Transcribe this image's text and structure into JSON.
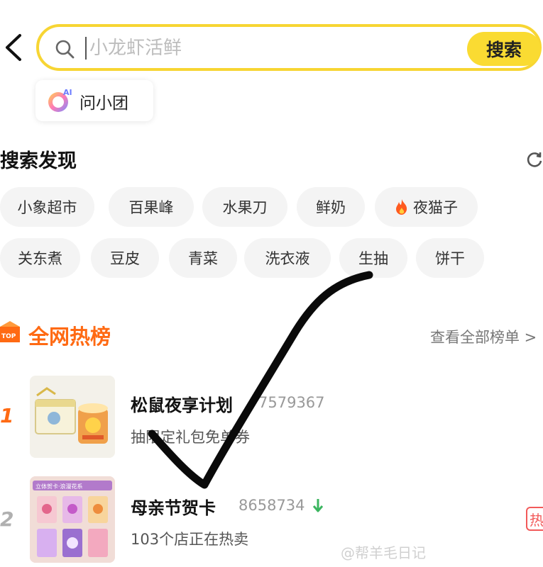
{
  "search": {
    "placeholder": "小龙虾活鲜",
    "button_label": "搜索"
  },
  "ai_chip": {
    "label": "问小团",
    "icon_badge": "AI"
  },
  "discover": {
    "title": "搜索发现",
    "row1": [
      "小象超市",
      "百果峰",
      "水果刀",
      "鲜奶",
      "夜猫子"
    ],
    "row2": [
      "关东煮",
      "豆皮",
      "青菜",
      "洗衣液",
      "生抽",
      "饼干"
    ]
  },
  "hot_list": {
    "badge": "TOP",
    "title": "全网热榜",
    "view_all": "查看全部榜单 >",
    "items": [
      {
        "rank": "1",
        "title": "松鼠夜享计划",
        "count": "7579367",
        "subtitle": "抽限定礼包免单券"
      },
      {
        "rank": "2",
        "title": "母亲节贺卡",
        "count": "8658734",
        "trend": "down",
        "subtitle": "103个店正在热卖",
        "thumb_caption": "立体贺卡·浪漫花系",
        "tag": "热"
      }
    ]
  },
  "watermark": "@帮羊毛日记",
  "colors": {
    "accent_yellow": "#fadb32",
    "hot_orange": "#ff6a13",
    "trend_green": "#3bb55f",
    "hot_tag_red": "#f25a5a"
  },
  "icons": [
    "back-arrow-icon",
    "search-icon",
    "ai-assistant-icon",
    "refresh-icon",
    "fire-icon",
    "top-badge-icon",
    "trend-down-icon"
  ]
}
